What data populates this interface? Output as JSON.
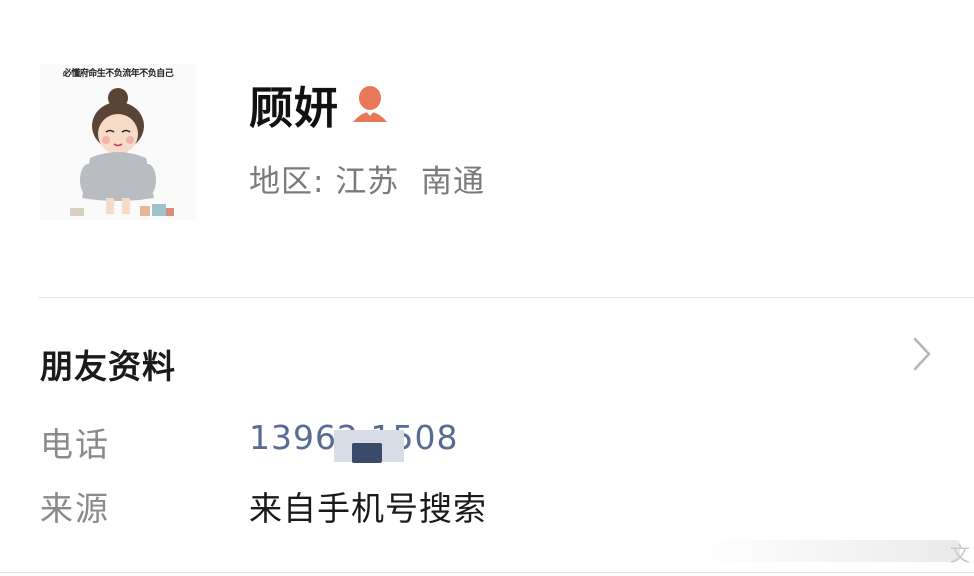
{
  "profile": {
    "avatar_caption": "必懂府命生不负流年不负自己",
    "name": "顾妍",
    "gender_icon": "female-icon",
    "region_label": "地区:",
    "region_value": "江苏  南通"
  },
  "section": {
    "title": "朋友资料",
    "chevron_icon": "chevron-right-icon"
  },
  "rows": [
    {
      "label": "电话",
      "value": "13962    1508"
    },
    {
      "label": "来源",
      "value": "来自手机号搜索"
    }
  ],
  "watermark": {
    "visible_char": "文"
  },
  "colors": {
    "link": "#576b95",
    "secondary_text": "#8a8a8a",
    "gender_icon": "#e8785a"
  }
}
